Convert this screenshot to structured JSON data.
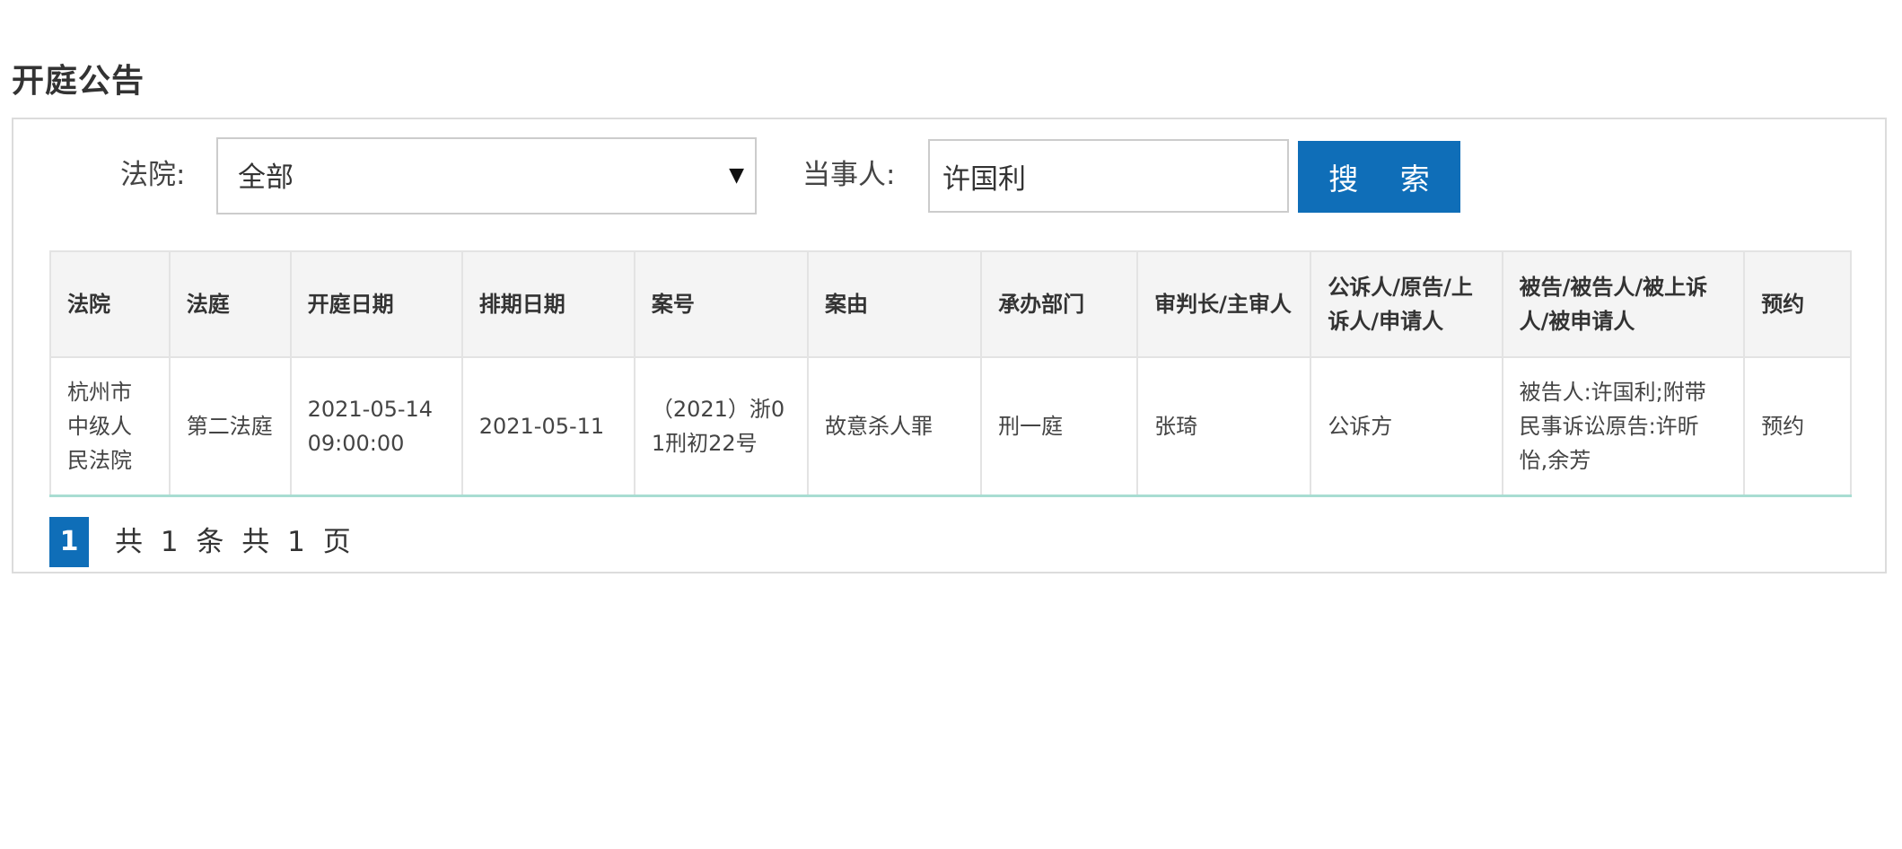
{
  "page_title": "开庭公告",
  "search": {
    "court_label": "法院:",
    "court_selected": "全部",
    "party_label": "当事人:",
    "party_value": "许国利",
    "search_button": "搜 索"
  },
  "table": {
    "headers": [
      "法院",
      "法庭",
      "开庭日期",
      "排期日期",
      "案号",
      "案由",
      "承办部门",
      "审判长/主审人",
      "公诉人/原告/上诉人/申请人",
      "被告/被告人/被上诉人/被申请人",
      "预约"
    ],
    "rows": [
      [
        "杭州市中级人民法院",
        "第二法庭",
        "2021-05-14 09:00:00",
        "2021-05-11",
        "（2021）浙01刑初22号",
        "故意杀人罪",
        "刑一庭",
        "张琦",
        "公诉方",
        "被告人:许国利;附带民事诉讼原告:许昕怡,余芳",
        "预约"
      ]
    ]
  },
  "pagination": {
    "current_page": "1",
    "summary": "共 1 条 共 1 页"
  }
}
